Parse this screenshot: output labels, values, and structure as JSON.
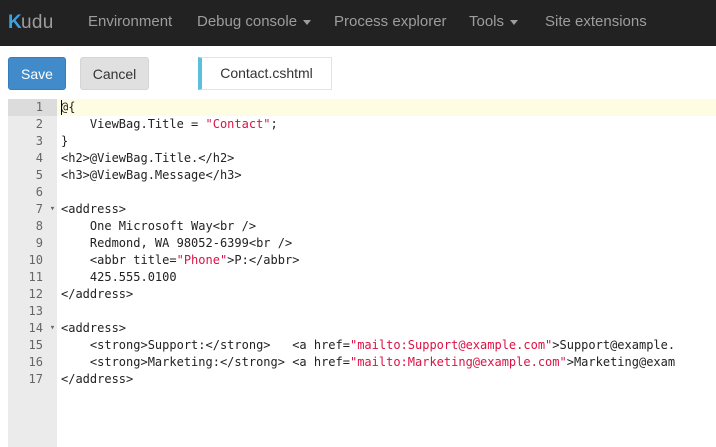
{
  "navbar": {
    "brand_k": "K",
    "brand_rest": "udu",
    "items": [
      {
        "label": "Environment"
      },
      {
        "label": "Debug console"
      },
      {
        "label": "Process explorer"
      },
      {
        "label": "Tools"
      },
      {
        "label": "Site extensions"
      }
    ]
  },
  "toolbar": {
    "save_label": "Save",
    "cancel_label": "Cancel",
    "file_tab": "Contact.cshtml"
  },
  "editor": {
    "line_numbers": [
      "1",
      "2",
      "3",
      "4",
      "5",
      "6",
      "7",
      "8",
      "9",
      "10",
      "11",
      "12",
      "13",
      "14",
      "15",
      "16",
      "17"
    ],
    "lines": [
      [
        "@{"
      ],
      [
        "    ViewBag.Title = "
      ],
      [
        "}"
      ],
      [
        "<h2>@ViewBag.Title.</h2>"
      ],
      [
        "<h3>@ViewBag.Message</h3>"
      ],
      [
        ""
      ],
      [
        "<address>"
      ],
      [
        "    One Microsoft Way<br />"
      ],
      [
        "    Redmond, WA 98052-6399<br />"
      ],
      [
        "    <abbr title="
      ],
      [
        "    425.555.0100"
      ],
      [
        "</address>"
      ],
      [
        ""
      ],
      [
        "<address>"
      ],
      [
        "    <strong>Support:</strong>   <a href="
      ],
      [
        "    <strong>Marketing:</strong> <a href="
      ],
      [
        "</address>"
      ]
    ],
    "strings": {
      "title_value": "\"Contact\"",
      "title_tail": ";",
      "abbr_value": "\"Phone\"",
      "abbr_tail": ">P:</abbr>",
      "support_href": "\"mailto:Support@example.com\"",
      "support_tail": ">Support@example.",
      "marketing_href": "\"mailto:Marketing@example.com\"",
      "marketing_tail": ">Marketing@exam"
    }
  }
}
